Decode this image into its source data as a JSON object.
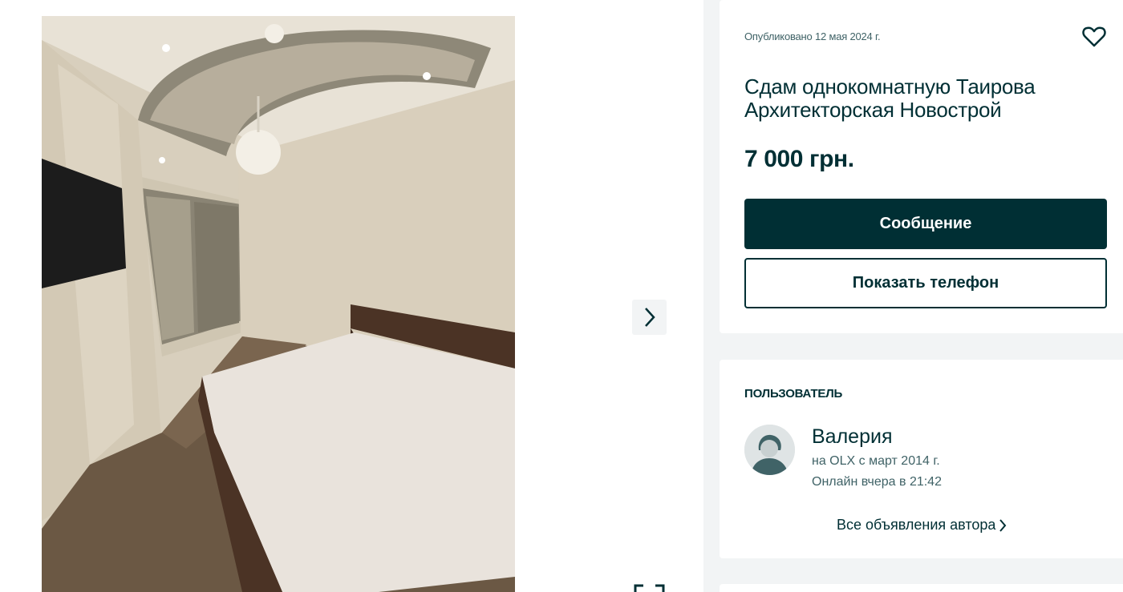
{
  "listing": {
    "posted": "Опубликовано 12 мая 2024 г.",
    "title": "Сдам однокомнатную Таирова Архитекторская Новострой",
    "price": "7 000 грн.",
    "message_button": "Сообщение",
    "phone_button": "Показать телефон"
  },
  "user": {
    "heading": "Пользователь",
    "name": "Валерия",
    "since": "на OLX с март 2014 г.",
    "online": "Онлайн вчера в 21:42",
    "all_ads": "Все объявления автора"
  },
  "icons": {
    "favorite": "heart-icon",
    "next": "chevron-right-icon",
    "all_ads": "chevron-right-icon",
    "expand": "expand-icon"
  },
  "colors": {
    "brand_dark": "#002f34",
    "muted_text": "#406367",
    "page_background": "#f2f4f5",
    "card_background": "#ffffff"
  }
}
